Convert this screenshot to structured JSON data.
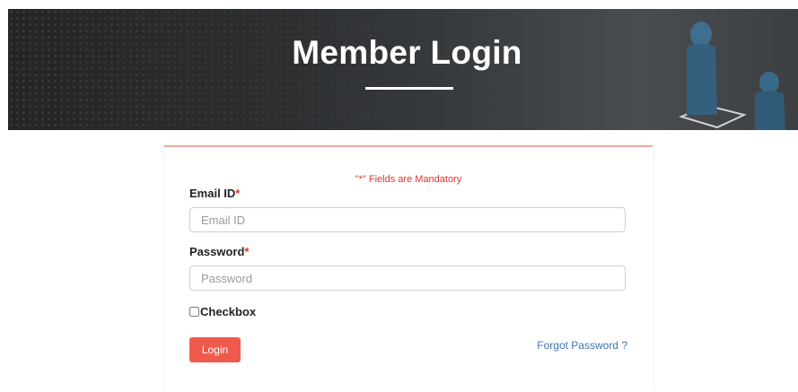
{
  "banner": {
    "title": "Member Login"
  },
  "form": {
    "mandatory_note": "\"*\" Fields are Mandatory",
    "email": {
      "label": "Email ID",
      "required_mark": "*",
      "placeholder": "Email ID",
      "value": ""
    },
    "password": {
      "label": "Password",
      "required_mark": "*",
      "placeholder": "Password",
      "value": ""
    },
    "checkbox": {
      "label": "Checkbox",
      "checked": false
    },
    "login_button": "Login",
    "forgot_link": "Forgot Password ?"
  },
  "colors": {
    "accent": "#ef5a4c",
    "required": "#d9332e",
    "link": "#3a76b5",
    "banner_dark": "#232526"
  }
}
